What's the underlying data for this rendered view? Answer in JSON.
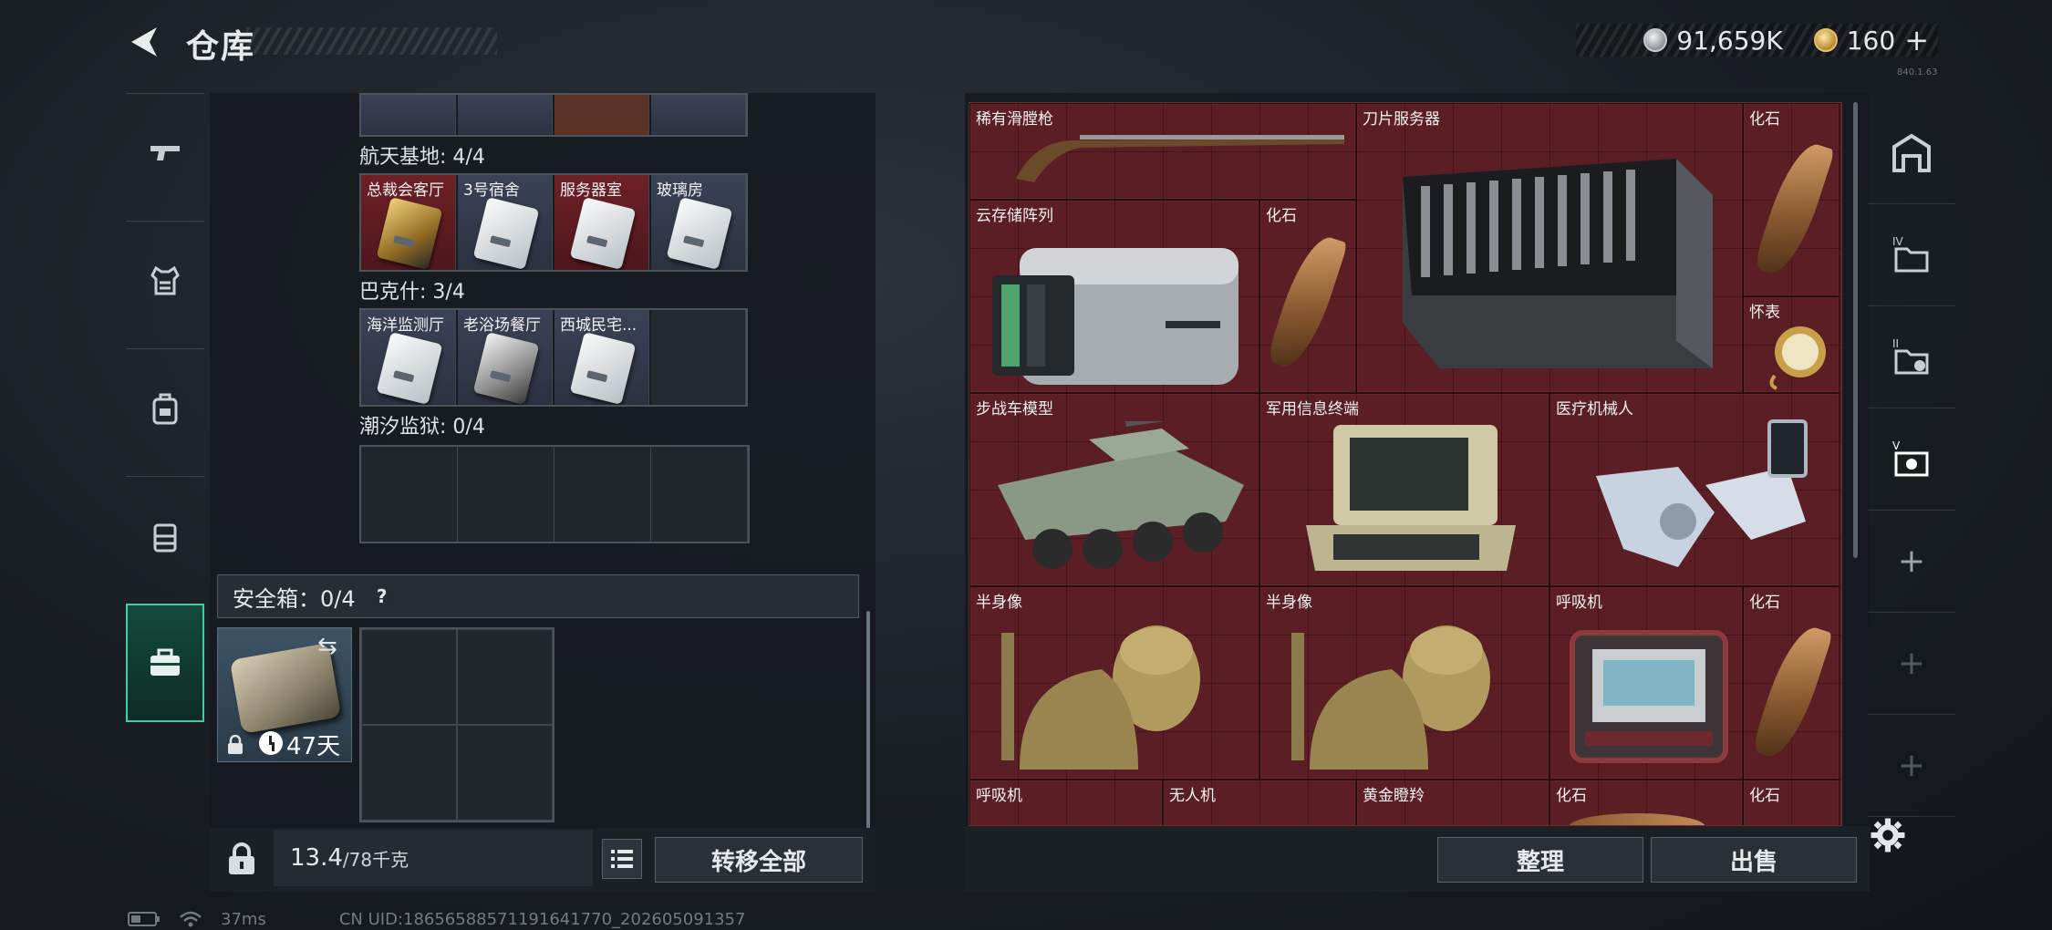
{
  "header": {
    "title": "仓库",
    "currency_silver": "91,659K",
    "currency_gold": "160",
    "currency_gold_plus": "+",
    "version": "840.1.63"
  },
  "left_nav": [
    "gun-icon",
    "armor-icon",
    "backpack-icon",
    "vest-icon",
    "case-icon"
  ],
  "locations": [
    {
      "label": "航天基地: 4/4",
      "cards": [
        {
          "name": "总裁会客厅",
          "style": "red",
          "card": "gold"
        },
        {
          "name": "3号宿舍",
          "style": "blue",
          "card": "white"
        },
        {
          "name": "服务器室",
          "style": "red",
          "card": "white"
        },
        {
          "name": "玻璃房",
          "style": "blue",
          "card": "white"
        }
      ]
    },
    {
      "label": "巴克什: 3/4",
      "cards": [
        {
          "name": "海洋监测厅",
          "style": "blue",
          "card": "white"
        },
        {
          "name": "老浴场餐厅",
          "style": "blue",
          "card": "dark"
        },
        {
          "name": "西城民宅...",
          "style": "blue",
          "card": "white"
        }
      ]
    },
    {
      "label": "潮汐监狱: 0/4",
      "cards": []
    }
  ],
  "safe_box": {
    "label": "安全箱：0/4",
    "help": "?",
    "days": "47天"
  },
  "capacity": {
    "current": "13.4",
    "max": "/78千克"
  },
  "buttons": {
    "transfer_all": "转移全部",
    "sort": "整理",
    "sell": "出售"
  },
  "items": {
    "rare_musket": "稀有滑膛枪",
    "blade_server": "刀片服务器",
    "fossil_1": "化石",
    "cloud_storage": "云存储阵列",
    "fossil_2": "化石",
    "pocket_watch": "怀表",
    "ifv_model": "步战车模型",
    "military_terminal": "军用信息终端",
    "medical_robot": "医疗机械人",
    "bust_1": "半身像",
    "bust_2": "半身像",
    "ventilator_1": "呼吸机",
    "fossil_3": "化石",
    "ventilator_2": "呼吸机",
    "drone": "无人机",
    "golden_gazelle": "黄金瞪羚",
    "fossil_4": "化石",
    "fossil_5": "化石"
  },
  "status_bar": {
    "ping": "37ms",
    "uid": "CN UID:18656588571191641770_202605091357"
  },
  "colors": {
    "accent_green": "#38d39f",
    "item_bg_red": "#5a1e24"
  }
}
